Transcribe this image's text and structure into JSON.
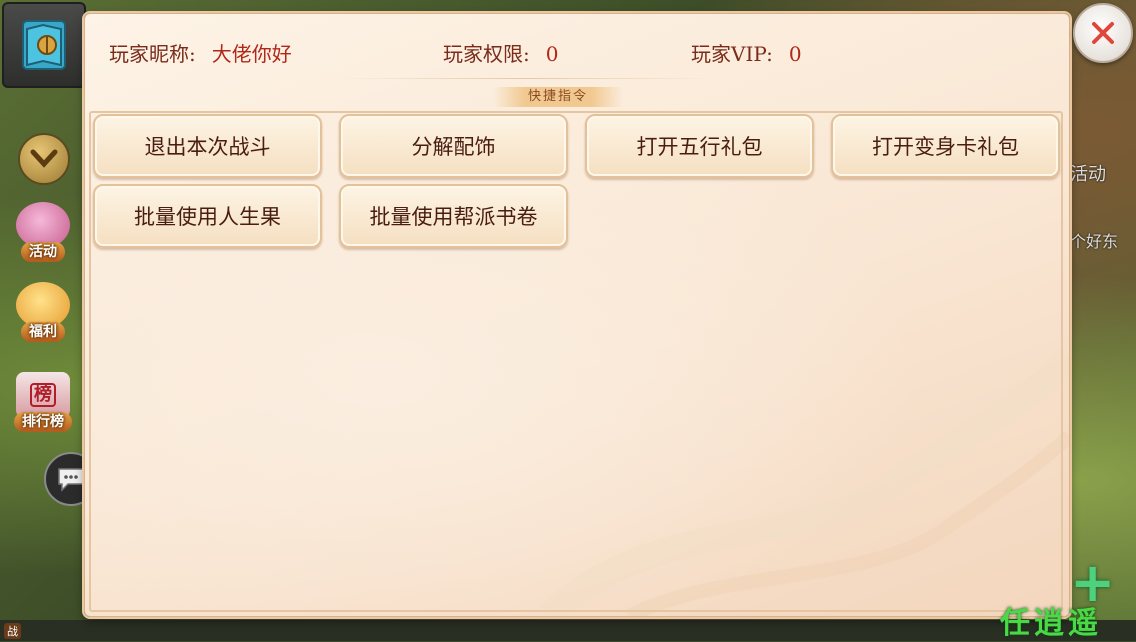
{
  "sidebar": {
    "activity_label": "活动",
    "welfare_label": "福利",
    "ranking_label": "排行榜",
    "ranking_badge": "榜"
  },
  "background": {
    "right_activity_text": "活动",
    "right_partial_text": "个好东",
    "bottom_tag": "战"
  },
  "player": {
    "nickname_label": "玩家昵称:",
    "nickname": "大佬你好",
    "permission_label": "玩家权限:",
    "permission": "0",
    "vip_label": "玩家VIP:",
    "vip": "0"
  },
  "section_title": "快捷指令",
  "commands": [
    {
      "label": "退出本次战斗"
    },
    {
      "label": "分解配饰"
    },
    {
      "label": "打开五行礼包"
    },
    {
      "label": "打开变身卡礼包"
    },
    {
      "label": "批量使用人生果"
    },
    {
      "label": "批量使用帮派书卷"
    }
  ],
  "watermark": "任逍遥",
  "icons": [
    "map-icon",
    "chevron-down-icon",
    "horn-icon",
    "welfare-character-icon",
    "ranking-icon",
    "chat-icon",
    "close-icon",
    "plus-icon"
  ],
  "colors": {
    "dialog_bg": "#fdf3e6",
    "button_bg": "#f5dfc1",
    "button_text": "#4a1d12",
    "info_text": "#7a2b1a",
    "close_x": "#e0463a",
    "watermark": "#4bd847"
  }
}
